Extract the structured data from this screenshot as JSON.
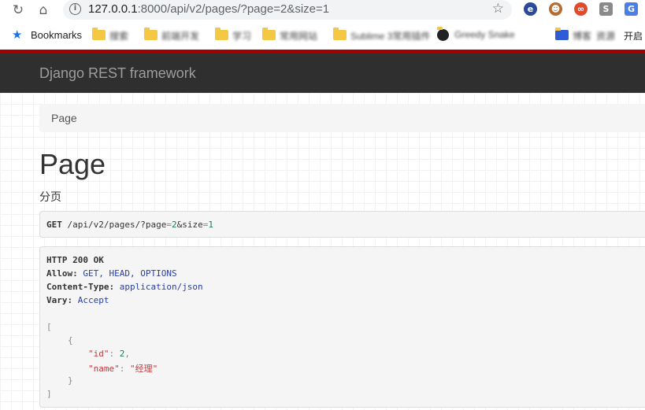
{
  "browser": {
    "url_host": "127.0.0.1",
    "url_rest": ":8000/api/v2/pages/?page=2&size=1",
    "bookmarks_label": "Bookmarks",
    "bookmark_end_label": "开启",
    "bookmark_items": [
      "搜索",
      "前端开发",
      "学习",
      "常用网站",
      "Sublime 3常用插件",
      "Greedy Snake",
      "博客",
      "资源"
    ]
  },
  "navbar": {
    "brand": "Django REST framework"
  },
  "breadcrumb": {
    "item": "Page"
  },
  "page": {
    "title": "Page",
    "description": "分页"
  },
  "request": {
    "method": "GET",
    "path": "/api/v2/pages/?page",
    "eq1": "=",
    "page_val": "2",
    "amp": "&size",
    "eq2": "=",
    "size_val": "1"
  },
  "response": {
    "status": "HTTP 200 OK",
    "allow_key": "Allow:",
    "allow_val": "GET, HEAD, OPTIONS",
    "ctype_key": "Content-Type:",
    "ctype_val": "application/json",
    "vary_key": "Vary:",
    "vary_val": "Accept",
    "open_bracket": "[",
    "open_brace": "{",
    "id_key": "\"id\"",
    "id_val": "2",
    "name_key": "\"name\"",
    "name_val": "\"经理\"",
    "close_brace": "}",
    "close_bracket": "]"
  },
  "colors": {
    "navbar_bg": "#2f2f2f",
    "navbar_accent": "#a30000"
  }
}
